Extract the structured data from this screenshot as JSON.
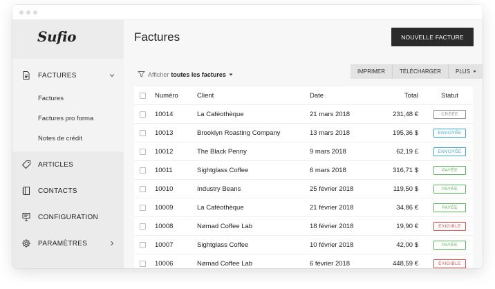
{
  "app": {
    "logo": "Sufio"
  },
  "colors": {
    "badge_cree": "#8a8a8a",
    "badge_envoyee": "#3aa8d8",
    "badge_payee": "#5cb85c",
    "badge_exigible": "#e05252"
  },
  "sidebar": {
    "factures": {
      "label": "FACTURES",
      "icon": "document-icon",
      "subitems": [
        "Factures",
        "Factures pro forma",
        "Notes de crédit"
      ]
    },
    "articles": {
      "label": "ARTICLES",
      "icon": "tag-icon"
    },
    "contacts": {
      "label": "CONTACTS",
      "icon": "address-book-icon"
    },
    "configuration": {
      "label": "CONFIGURATION",
      "icon": "form-icon"
    },
    "parametres": {
      "label": "PARAMÈTRES",
      "icon": "gear-icon"
    }
  },
  "header": {
    "title": "Factures",
    "new_invoice": "NOUVELLE FACTURE"
  },
  "toolbar": {
    "filter_prefix": "Afficher",
    "filter_value": "toutes les factures",
    "print": "IMPRIMER",
    "download": "TÉLÉCHARGER",
    "more": "PLUS"
  },
  "table": {
    "columns": {
      "number": "Numéro",
      "client": "Client",
      "date": "Date",
      "total": "Total",
      "status": "Statut"
    },
    "rows": [
      {
        "number": "10014",
        "client": "La Caféothèque",
        "date": "21 mars 2018",
        "total": "231,48 €",
        "status": "CRÉÉE",
        "kind": "cree"
      },
      {
        "number": "10013",
        "client": "Brooklyn Roasting Company",
        "date": "13 mars 2018",
        "total": "195,36 $",
        "status": "ENVOYÉE",
        "kind": "envoyee"
      },
      {
        "number": "10012",
        "client": "The Black Penny",
        "date": "9 mars 2018",
        "total": "62,19 £",
        "status": "ENVOYÉE",
        "kind": "envoyee"
      },
      {
        "number": "10011",
        "client": "Sightglass Coffee",
        "date": "6 mars 2018",
        "total": "316,71 $",
        "status": "PAYÉE",
        "kind": "payee"
      },
      {
        "number": "10010",
        "client": "Industry Beans",
        "date": "25 février 2018",
        "total": "119,50 $",
        "status": "PAYÉE",
        "kind": "payee"
      },
      {
        "number": "10009",
        "client": "La Caféothèque",
        "date": "21 février 2018",
        "total": "34,86 €",
        "status": "PAYÉE",
        "kind": "payee"
      },
      {
        "number": "10008",
        "client": "Nømad Coffee Lab",
        "date": "18 février 2018",
        "total": "19,90 €",
        "status": "EXIGIBLE",
        "kind": "exigible"
      },
      {
        "number": "10007",
        "client": "Sightglass Coffee",
        "date": "10 février 2018",
        "total": "42,00 $",
        "status": "PAYÉE",
        "kind": "payee"
      },
      {
        "number": "10006",
        "client": "Nømad Coffee Lab",
        "date": "6 février 2018",
        "total": "448,59 €",
        "status": "EXIGIBLE",
        "kind": "exigible"
      }
    ]
  }
}
